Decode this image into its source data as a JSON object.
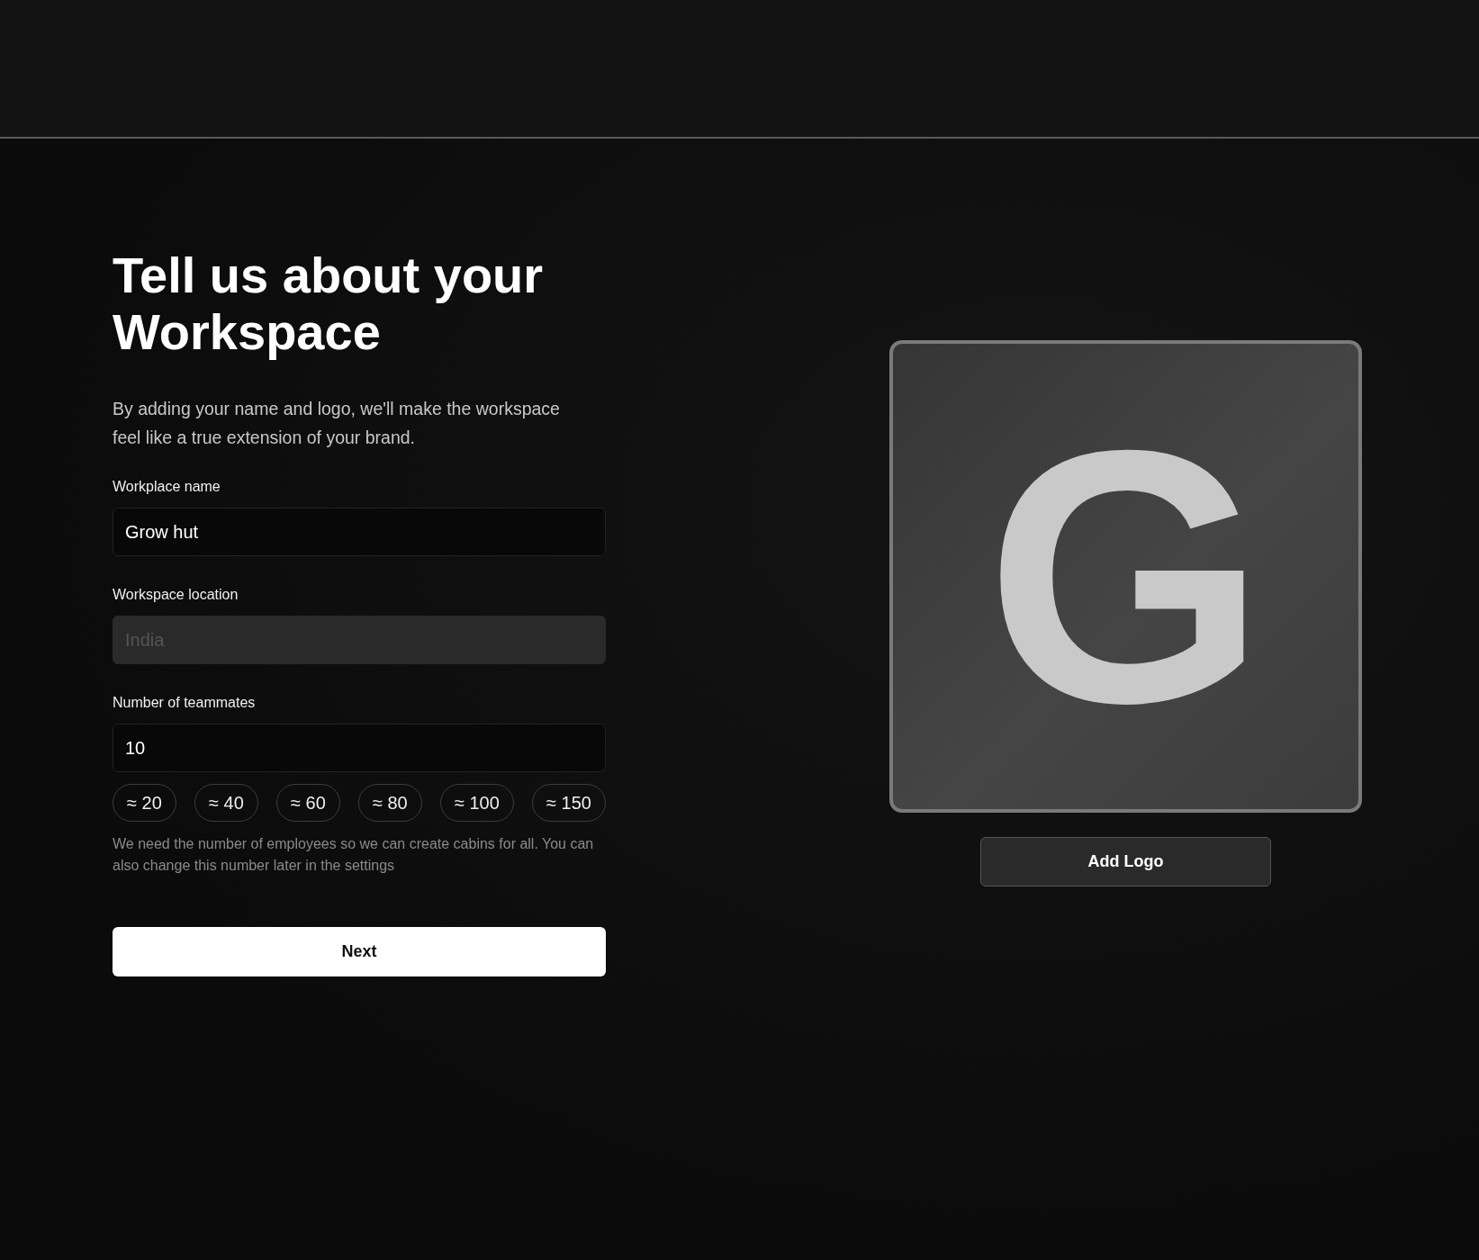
{
  "heading": "Tell us about your Workspace",
  "intro": "By adding your name and logo, we'll make the workspace feel like a true extension of your brand.",
  "fields": [
    {
      "label": "Workplace name",
      "value": "Grow hut",
      "disabled": false
    },
    {
      "label": "Workspace location",
      "placeholder": "India",
      "disabled": true
    },
    {
      "label": "Number of teammates",
      "value": "10",
      "disabled": false
    }
  ],
  "team_size_options": [
    {
      "label": "≈ 20",
      "selected": false
    },
    {
      "label": "≈ 40",
      "selected": false
    },
    {
      "label": "≈ 60",
      "selected": false
    },
    {
      "label": "≈ 80",
      "selected": false
    },
    {
      "label": "≈ 100",
      "selected": false
    },
    {
      "label": "≈ 150",
      "selected": false
    }
  ],
  "help_text": "We need the number of employees so we can create cabins for all. You can also change this number later in the settings",
  "next_button": "Next",
  "logo_preview": {
    "letter": "G"
  },
  "add_logo_button": "Add Logo"
}
